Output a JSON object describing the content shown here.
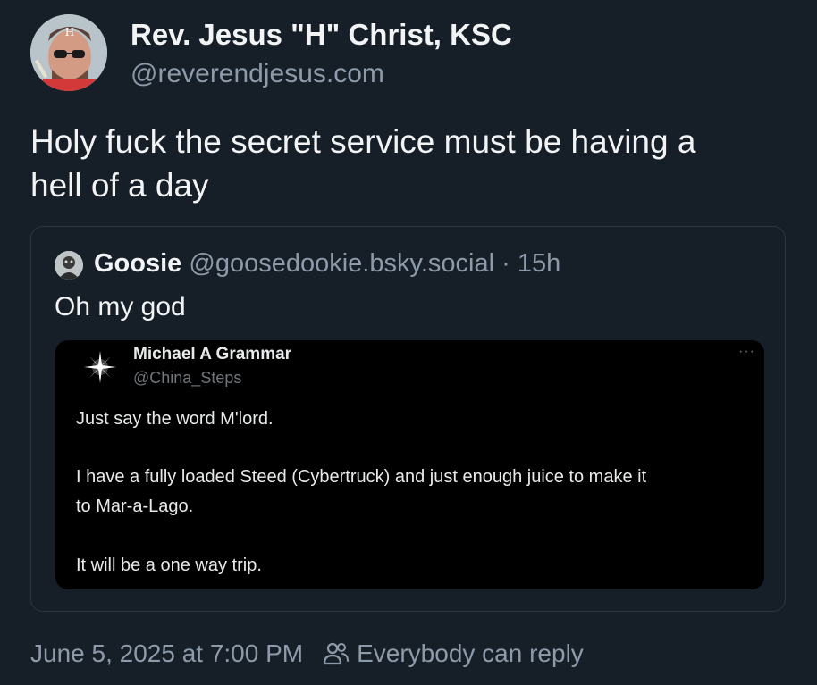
{
  "post": {
    "author": {
      "display_name": "Rev. Jesus \"H\" Christ, KSC",
      "handle": "@reverendjesus.com",
      "avatar_icon": "avatar-portrait"
    },
    "text_line1": "Holy fuck the secret service must be having a",
    "text_line2": "hell of a day",
    "quote": {
      "author_name": "Goosie",
      "author_handle": "@goosedookie.bsky.social",
      "separator": "·",
      "time_ago": "15h",
      "text": "Oh my god",
      "avatar_icon": "avatar-portrait",
      "embedded_image": {
        "name": "Michael A Grammar",
        "handle": "@China_Steps",
        "more_label": "···",
        "avatar_icon": "sparkle-star",
        "lines": [
          "Just say the word M'lord.",
          "I have a fully loaded Steed (Cybertruck) and just enough juice to make it",
          "to Mar-a-Lago.",
          "It will be a one way trip."
        ]
      }
    },
    "footer": {
      "timestamp": "June 5, 2025 at 7:00 PM",
      "reply_setting": "Everybody can reply",
      "reply_icon": "people-icon"
    }
  },
  "colors": {
    "background": "#161e27",
    "text_primary": "#f1f3f5",
    "text_secondary": "#8d9aa9",
    "card_border": "#2b3744",
    "embed_background": "#000000"
  }
}
